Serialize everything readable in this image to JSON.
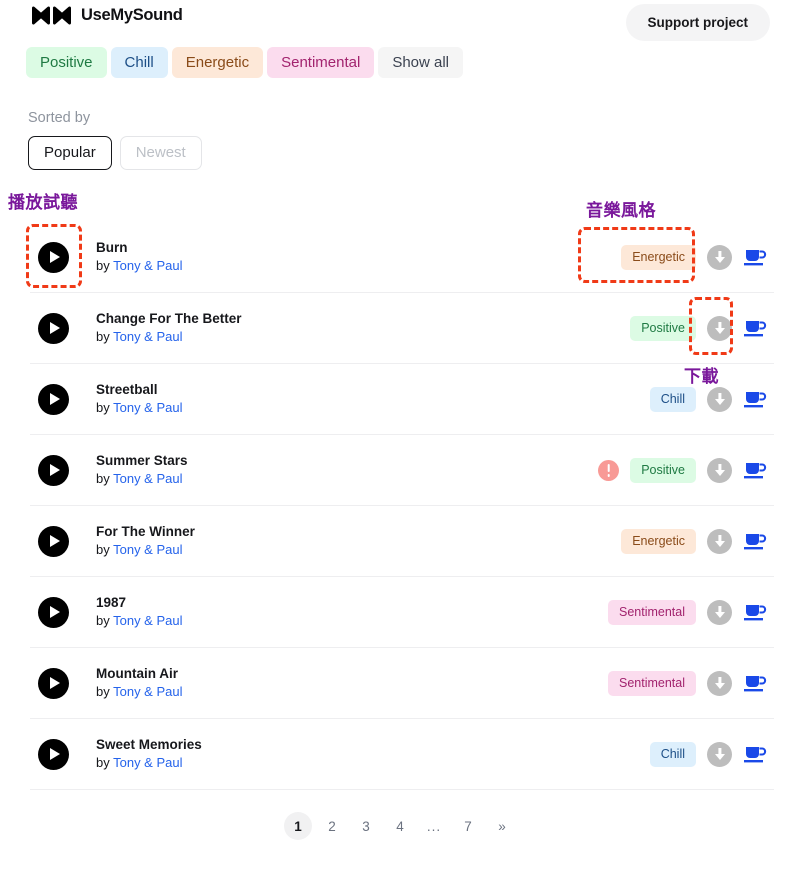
{
  "header": {
    "logo_text": "UseMySound",
    "logo_icon": "zigzag-wave-logo-icon",
    "support_button": "Support project"
  },
  "filters": {
    "items": [
      {
        "label": "Positive",
        "style": "positive"
      },
      {
        "label": "Chill",
        "style": "chill"
      },
      {
        "label": "Energetic",
        "style": "energetic"
      },
      {
        "label": "Sentimental",
        "style": "sentimental"
      },
      {
        "label": "Show all",
        "style": "showall"
      }
    ]
  },
  "sort": {
    "label": "Sorted by",
    "options": [
      {
        "label": "Popular",
        "active": true
      },
      {
        "label": "Newest",
        "active": false
      }
    ]
  },
  "tracks": [
    {
      "title": "Burn",
      "by_prefix": "by ",
      "artist": "Tony & Paul",
      "mood": "Energetic",
      "mood_style": "energetic",
      "warning": false,
      "play_icon": "play-icon",
      "download_icon": "download-icon",
      "coffee_icon": "coffee-cup-icon"
    },
    {
      "title": "Change For The Better",
      "by_prefix": "by ",
      "artist": "Tony & Paul",
      "mood": "Positive",
      "mood_style": "positive",
      "warning": false,
      "play_icon": "play-icon",
      "download_icon": "download-icon",
      "coffee_icon": "coffee-cup-icon"
    },
    {
      "title": "Streetball",
      "by_prefix": "by ",
      "artist": "Tony & Paul",
      "mood": "Chill",
      "mood_style": "chill",
      "warning": false,
      "play_icon": "play-icon",
      "download_icon": "download-icon",
      "coffee_icon": "coffee-cup-icon"
    },
    {
      "title": "Summer Stars",
      "by_prefix": "by ",
      "artist": "Tony & Paul",
      "mood": "Positive",
      "mood_style": "positive",
      "warning": true,
      "play_icon": "play-icon",
      "download_icon": "download-icon",
      "coffee_icon": "coffee-cup-icon"
    },
    {
      "title": "For The Winner",
      "by_prefix": "by ",
      "artist": "Tony & Paul",
      "mood": "Energetic",
      "mood_style": "energetic",
      "warning": false,
      "play_icon": "play-icon",
      "download_icon": "download-icon",
      "coffee_icon": "coffee-cup-icon"
    },
    {
      "title": "1987",
      "by_prefix": "by ",
      "artist": "Tony & Paul",
      "mood": "Sentimental",
      "mood_style": "sentimental",
      "warning": false,
      "play_icon": "play-icon",
      "download_icon": "download-icon",
      "coffee_icon": "coffee-cup-icon"
    },
    {
      "title": "Mountain Air",
      "by_prefix": "by ",
      "artist": "Tony & Paul",
      "mood": "Sentimental",
      "mood_style": "sentimental",
      "warning": false,
      "play_icon": "play-icon",
      "download_icon": "download-icon",
      "coffee_icon": "coffee-cup-icon"
    },
    {
      "title": "Sweet Memories",
      "by_prefix": "by ",
      "artist": "Tony & Paul",
      "mood": "Chill",
      "mood_style": "chill",
      "warning": false,
      "play_icon": "play-icon",
      "download_icon": "download-icon",
      "coffee_icon": "coffee-cup-icon"
    }
  ],
  "pagination": {
    "items": [
      {
        "label": "1",
        "active": true,
        "kind": "page"
      },
      {
        "label": "2",
        "active": false,
        "kind": "page"
      },
      {
        "label": "3",
        "active": false,
        "kind": "page"
      },
      {
        "label": "4",
        "active": false,
        "kind": "page"
      },
      {
        "label": "...",
        "active": false,
        "kind": "ellipsis"
      },
      {
        "label": "7",
        "active": false,
        "kind": "page"
      },
      {
        "label": "»",
        "active": false,
        "kind": "next"
      }
    ]
  },
  "annotations": {
    "play_label": "播放試聽",
    "mood_label": "音樂風格",
    "download_label": "下載",
    "text_color": "#7a189b",
    "box_color": "#f03a17"
  }
}
